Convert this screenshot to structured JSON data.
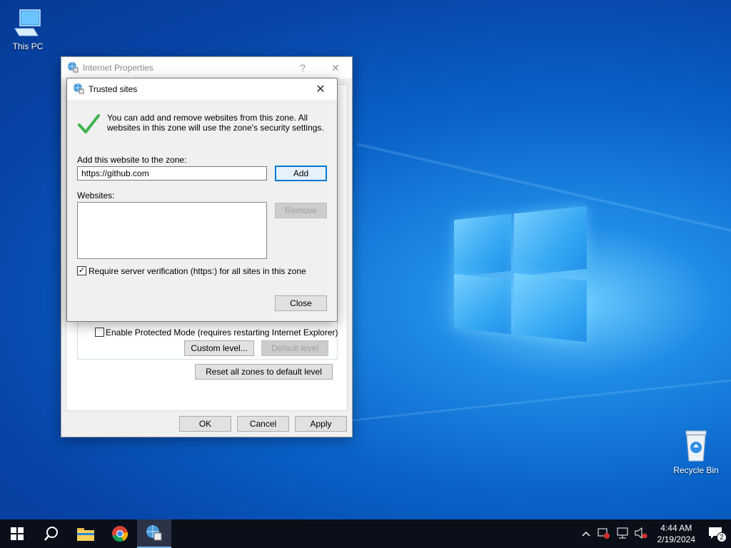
{
  "desktop": {
    "icons": [
      {
        "label": "This PC"
      },
      {
        "label": "Recycle Bin"
      }
    ]
  },
  "internet_properties": {
    "title": "Internet Properties",
    "help_button": "?",
    "close_button": "✕",
    "protected_mode_label": "Enable Protected Mode (requires restarting Internet Explorer)",
    "custom_level_button": "Custom level...",
    "default_level_button": "Default level",
    "reset_all_button": "Reset all zones to default level",
    "ok_button": "OK",
    "cancel_button": "Cancel",
    "apply_button": "Apply"
  },
  "trusted_sites": {
    "title": "Trusted sites",
    "close_button": "✕",
    "info_text": "You can add and remove websites from this zone. All websites in this zone will use the zone's security settings.",
    "add_label": "Add this website to the zone:",
    "add_value": "https://github.com",
    "add_button": "Add",
    "websites_label": "Websites:",
    "remove_button": "Remove",
    "require_https_label": "Require server verification (https:) for all sites in this zone",
    "require_https_checked": "✓",
    "close_dialog_button": "Close"
  },
  "taskbar": {
    "time": "4:44 AM",
    "date": "2/19/2024",
    "notification_count": "2"
  }
}
